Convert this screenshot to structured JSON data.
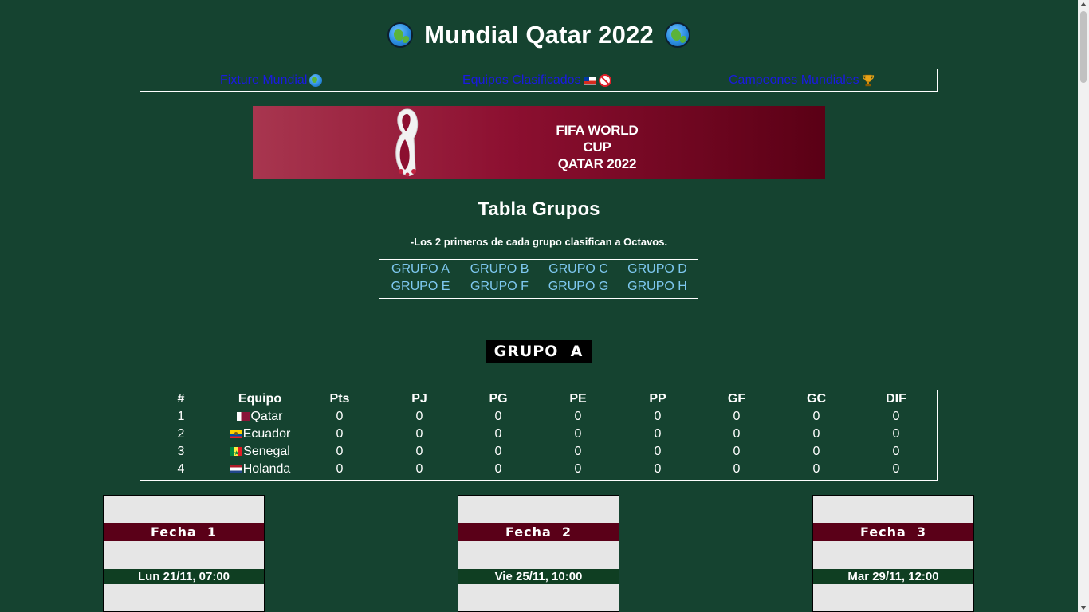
{
  "header": {
    "title": "Mundial Qatar 2022",
    "left_icon": "globe-icon",
    "right_icon": "globe-icon"
  },
  "nav": {
    "items": [
      {
        "label": "Fixture Mundial",
        "icon": "globe-icon"
      },
      {
        "label": "Equipos Clasificados",
        "icon": "chile-flag-no-entry-icon"
      },
      {
        "label": "Campeones Mundiales",
        "icon": "trophy-icon"
      }
    ],
    "link_color": "#1a1ae0"
  },
  "banner": {
    "line1": "FIFA WORLD CUP",
    "line2": "QATAR 2022",
    "colors": [
      "#a8364f",
      "#8c0f30",
      "#5a0015"
    ]
  },
  "section": {
    "title": "Tabla Grupos",
    "note": "-Los 2 primeros de cada grupo clasifican a Octavos."
  },
  "groups": {
    "links": [
      "GRUPO A",
      "GRUPO B",
      "GRUPO C",
      "GRUPO D",
      "GRUPO E",
      "GRUPO F",
      "GRUPO G",
      "GRUPO H"
    ],
    "link_color": "#7ec8f0"
  },
  "current_group": {
    "label": "GRUPO  A"
  },
  "standings": {
    "headers": [
      "#",
      "Equipo",
      "Pts",
      "PJ",
      "PG",
      "PE",
      "PP",
      "GF",
      "GC",
      "DIF"
    ],
    "rows": [
      {
        "pos": "1",
        "team": "Qatar",
        "flag": "qatar-flag",
        "pts": "0",
        "pj": "0",
        "pg": "0",
        "pe": "0",
        "pp": "0",
        "gf": "0",
        "gc": "0",
        "dif": "0"
      },
      {
        "pos": "2",
        "team": "Ecuador",
        "flag": "ecuador-flag",
        "pts": "0",
        "pj": "0",
        "pg": "0",
        "pe": "0",
        "pp": "0",
        "gf": "0",
        "gc": "0",
        "dif": "0"
      },
      {
        "pos": "3",
        "team": "Senegal",
        "flag": "senegal-flag",
        "pts": "0",
        "pj": "0",
        "pg": "0",
        "pe": "0",
        "pp": "0",
        "gf": "0",
        "gc": "0",
        "dif": "0"
      },
      {
        "pos": "4",
        "team": "Holanda",
        "flag": "netherlands-flag",
        "pts": "0",
        "pj": "0",
        "pg": "0",
        "pe": "0",
        "pp": "0",
        "gf": "0",
        "gc": "0",
        "dif": "0"
      }
    ]
  },
  "fechas": [
    {
      "title": "Fecha  1",
      "date": "Lun 21/11, 07:00"
    },
    {
      "title": "Fecha  2",
      "date": "Vie 25/11, 10:00"
    },
    {
      "title": "Fecha  3",
      "date": "Mar 29/11, 12:00"
    }
  ],
  "colors": {
    "background": "#154330",
    "group_header_bg": "#000000",
    "fecha_title_bg": "#5a0018",
    "fecha_date_bg": "#0f3e22",
    "card_bg": "#e6e6e6"
  }
}
